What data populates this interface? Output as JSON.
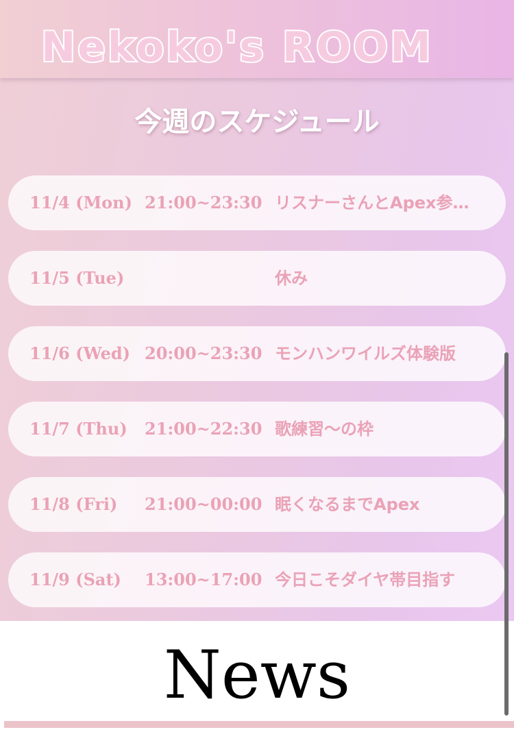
{
  "header": {
    "logo_text": "Nekoko's ROOM"
  },
  "schedule": {
    "title": "今週のスケジュール",
    "items": [
      {
        "date": "11/4 (Mon)",
        "time": "21:00~23:30",
        "event": "リスナーさんとApex参加型"
      },
      {
        "date": "11/5 (Tue)",
        "time": "",
        "event": "休み"
      },
      {
        "date": "11/6 (Wed)",
        "time": "20:00~23:30",
        "event": "モンハンワイルズ体験版"
      },
      {
        "date": "11/7 (Thu)",
        "time": "21:00~22:30",
        "event": "歌練習〜の枠"
      },
      {
        "date": "11/8 (Fri)",
        "time": "21:00~00:00",
        "event": "眠くなるまでApex"
      },
      {
        "date": "11/9 (Sat)",
        "time": "13:00~17:00",
        "event": "今日こそダイヤ帯目指す"
      }
    ]
  },
  "news": {
    "title": "News"
  },
  "colors": {
    "accent_pink": "#eaa2b6",
    "logo_fill": "#f6cbe0",
    "divider": "#ebc3c9"
  }
}
